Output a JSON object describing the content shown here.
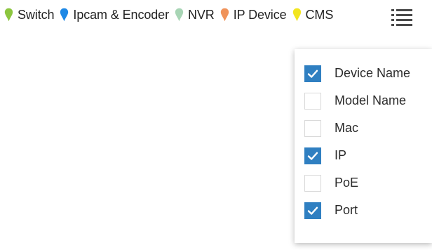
{
  "legend": [
    {
      "label": "Switch",
      "color": "#8cc63f",
      "icon": "map-pin-icon"
    },
    {
      "label": "Ipcam & Encoder",
      "color": "#1e88e5",
      "icon": "map-pin-icon"
    },
    {
      "label": "NVR",
      "color": "#a8d5b5",
      "icon": "map-pin-icon"
    },
    {
      "label": "IP Device",
      "color": "#f0935a",
      "icon": "map-pin-icon"
    },
    {
      "label": "CMS",
      "color": "#f2e51f",
      "icon": "map-pin-icon"
    }
  ],
  "menu": {
    "icon": "list-menu-icon"
  },
  "columns": [
    {
      "label": "Device Name",
      "checked": true
    },
    {
      "label": "Model Name",
      "checked": false
    },
    {
      "label": "Mac",
      "checked": false
    },
    {
      "label": "IP",
      "checked": true
    },
    {
      "label": "PoE",
      "checked": false
    },
    {
      "label": "Port",
      "checked": true
    }
  ],
  "colors": {
    "checkbox_checked": "#2f7fc1",
    "checkbox_border": "#d9d9d9"
  }
}
